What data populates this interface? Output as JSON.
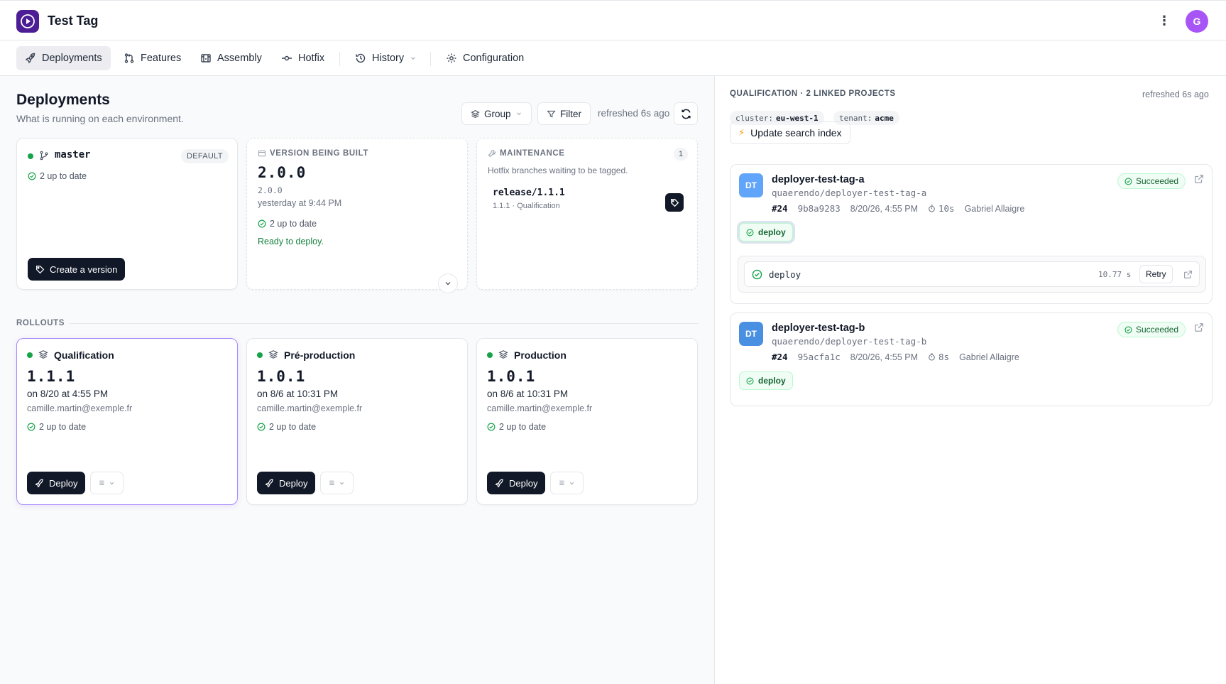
{
  "app": {
    "title": "Test Tag",
    "avatar_initial": "G"
  },
  "nav": {
    "deployments": "Deployments",
    "features": "Features",
    "assembly": "Assembly",
    "hotfix": "Hotfix",
    "history": "History",
    "configuration": "Configuration"
  },
  "page": {
    "title": "Deployments",
    "subtitle": "What is running on each environment.",
    "group_label": "Group",
    "filter_label": "Filter",
    "refreshed": "refreshed 6s ago"
  },
  "master_card": {
    "branch": "master",
    "badge": "DEFAULT",
    "status": "2 up to date",
    "button": "Create a version"
  },
  "build_card": {
    "label": "VERSION BEING BUILT",
    "version": "2.0.0",
    "version_small": "2.0.0",
    "time": "yesterday at 9:44 PM",
    "status": "2 up to date",
    "ready": "Ready to deploy."
  },
  "maintenance_card": {
    "label": "MAINTENANCE",
    "count": "1",
    "description": "Hotfix branches waiting to be tagged.",
    "branch": "release/1.1.1",
    "branch_meta": "1.1.1 · Qualification"
  },
  "rollouts": {
    "label": "ROLLOUTS",
    "envs": [
      {
        "name": "Qualification",
        "version": "1.1.1",
        "date": "on 8/20 at 4:55 PM",
        "user": "camille.martin@exemple.fr",
        "status": "2 up to date",
        "button": "Deploy"
      },
      {
        "name": "Pré-production",
        "version": "1.0.1",
        "date": "on 8/6 at 10:31 PM",
        "user": "camille.martin@exemple.fr",
        "status": "2 up to date",
        "button": "Deploy"
      },
      {
        "name": "Production",
        "version": "1.0.1",
        "date": "on 8/6 at 10:31 PM",
        "user": "camille.martin@exemple.fr",
        "status": "2 up to date",
        "button": "Deploy"
      }
    ]
  },
  "side": {
    "heading": "QUALIFICATION · 2 LINKED PROJECTS",
    "refreshed": "refreshed 6s ago",
    "chips": [
      {
        "key": "cluster:",
        "value": "eu-west-1"
      },
      {
        "key": "tenant:",
        "value": "acme"
      }
    ],
    "action": "Update search index",
    "projects": [
      {
        "initials": "DT",
        "name": "deployer-test-tag-a",
        "path": "quaerendo/deployer-test-tag-a",
        "pipeline": "#24",
        "sha": "9b8a9283",
        "date": "8/20/26, 4:55 PM",
        "duration": "10s",
        "author": "Gabriel Allaigre",
        "status": "Succeeded",
        "job": "deploy",
        "job_detail": {
          "name": "deploy",
          "time": "10.77 s",
          "retry": "Retry"
        },
        "color": "#60a5fa"
      },
      {
        "initials": "DT",
        "name": "deployer-test-tag-b",
        "path": "quaerendo/deployer-test-tag-b",
        "pipeline": "#24",
        "sha": "95acfa1c",
        "date": "8/20/26, 4:55 PM",
        "duration": "8s",
        "author": "Gabriel Allaigre",
        "status": "Succeeded",
        "job": "deploy",
        "color": "#4a90e2"
      }
    ]
  }
}
